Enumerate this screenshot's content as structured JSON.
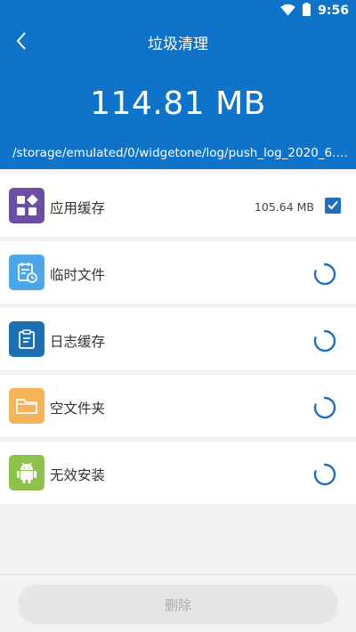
{
  "status_bar": {
    "time": "9:56"
  },
  "nav": {
    "title": "垃圾清理"
  },
  "summary": {
    "total_size": "114.81 MB",
    "scan_path": "/storage/emulated/0/widgetone/log/push_log_2020_6.l..."
  },
  "items": [
    {
      "label": "应用缓存",
      "size": "105.64 MB",
      "state": "checked",
      "icon": "app-grid-icon",
      "color": "#6a4fa3"
    },
    {
      "label": "临时文件",
      "size": "",
      "state": "loading",
      "icon": "temp-file-icon",
      "color": "#4ba6ea"
    },
    {
      "label": "日志缓存",
      "size": "",
      "state": "loading",
      "icon": "clipboard-icon",
      "color": "#1b6fb5"
    },
    {
      "label": "空文件夹",
      "size": "",
      "state": "loading",
      "icon": "folder-icon",
      "color": "#f5b35a"
    },
    {
      "label": "无效安装",
      "size": "",
      "state": "loading",
      "icon": "android-icon",
      "color": "#8fc24a"
    }
  ],
  "actions": {
    "delete_label": "删除"
  },
  "colors": {
    "header": "#0f74c9",
    "accent": "#1f6fbf"
  }
}
